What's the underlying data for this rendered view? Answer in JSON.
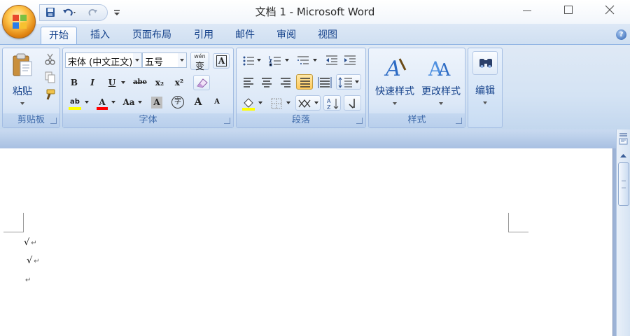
{
  "window": {
    "title": "文档 1 - Microsoft Word",
    "controls": [
      "minimize",
      "maximize",
      "close"
    ]
  },
  "quick_access": {
    "buttons": [
      "save-icon",
      "undo-icon",
      "redo-icon"
    ],
    "customize": "customize-qat-icon"
  },
  "ribbon": {
    "tabs": [
      {
        "label": "开始",
        "active": true
      },
      {
        "label": "插入",
        "active": false
      },
      {
        "label": "页面布局",
        "active": false
      },
      {
        "label": "引用",
        "active": false
      },
      {
        "label": "邮件",
        "active": false
      },
      {
        "label": "审阅",
        "active": false
      },
      {
        "label": "视图",
        "active": false
      }
    ],
    "groups": {
      "clipboard": {
        "label": "剪贴板",
        "paste_label": "粘贴",
        "buttons": [
          "cut-icon",
          "copy-icon",
          "format-painter-icon"
        ]
      },
      "font": {
        "label": "字体",
        "font_name": "宋体 (中文正文)",
        "font_size": "五号",
        "phonetic_glyph": "wén",
        "phonetic_char": "变",
        "border_glyph": "A",
        "bold": "B",
        "italic": "I",
        "underline": "U",
        "strike": "abe",
        "subscript": "x₂",
        "superscript": "x²",
        "highlight_glyph": "ab",
        "font_color_glyph": "A",
        "change_case": "Aa",
        "shading_glyph": "A",
        "enclose_char": "字",
        "grow": "A",
        "shrink": "A"
      },
      "paragraph": {
        "label": "段落"
      },
      "styles": {
        "label": "样式",
        "quick_styles": "快速样式",
        "change_styles": "更改样式"
      },
      "editing": {
        "label": "编辑"
      }
    },
    "accent": "#15428b"
  },
  "document": {
    "lines": [
      "√",
      "√",
      ""
    ],
    "paragraph_mark": "↵"
  }
}
